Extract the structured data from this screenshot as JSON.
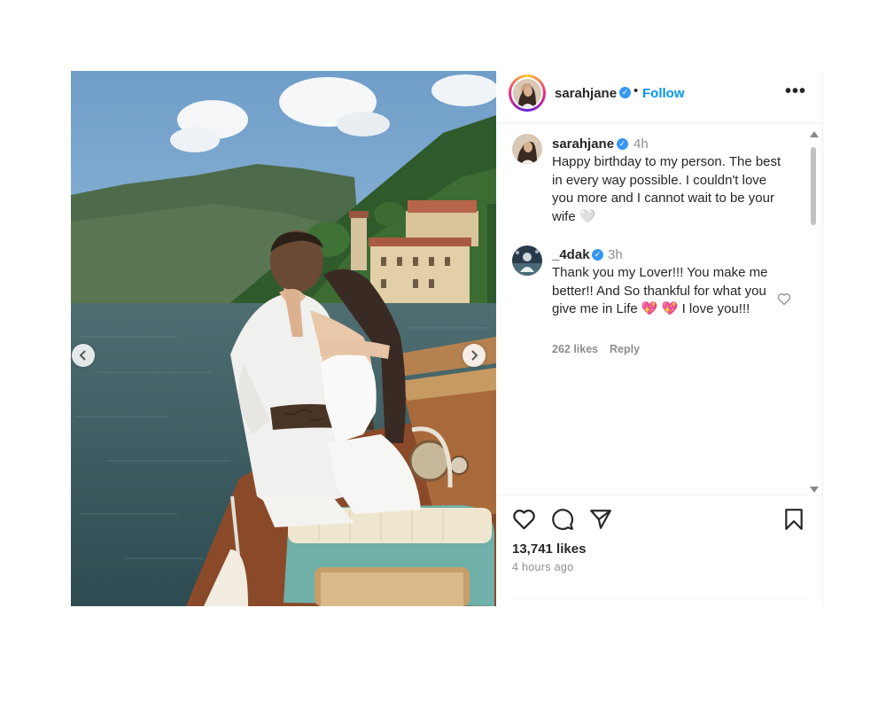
{
  "post": {
    "username": "sarahjane",
    "dot": "•",
    "follow_label": "Follow",
    "more_label": "•••"
  },
  "comments": [
    {
      "username": "sarahjane",
      "time": "4h",
      "text": "Happy birthday to my person. The best in every way possible. I couldn't love you more and I cannot wait to be your wife 🤍"
    },
    {
      "username": "_4dak",
      "time": "3h",
      "text": "Thank you my Lover!!! You make me better!! And So thankful for what you give me in Life 💖 💖  I love you!!!",
      "likes": "262 likes",
      "reply_label": "Reply"
    }
  ],
  "footer": {
    "likes": "13,741 likes",
    "time_ago": "4 hours ago"
  },
  "icons": {
    "verified": "verified-badge-icon",
    "prev": "chevron-left-icon",
    "next": "chevron-right-icon",
    "like": "heart-icon",
    "comment": "comment-icon",
    "share": "paper-plane-icon",
    "save": "bookmark-icon",
    "more": "more-options-icon"
  },
  "colors": {
    "accent": "#0095f6",
    "verified": "#3897f0",
    "text": "#262626",
    "muted": "#8e8e8e"
  }
}
